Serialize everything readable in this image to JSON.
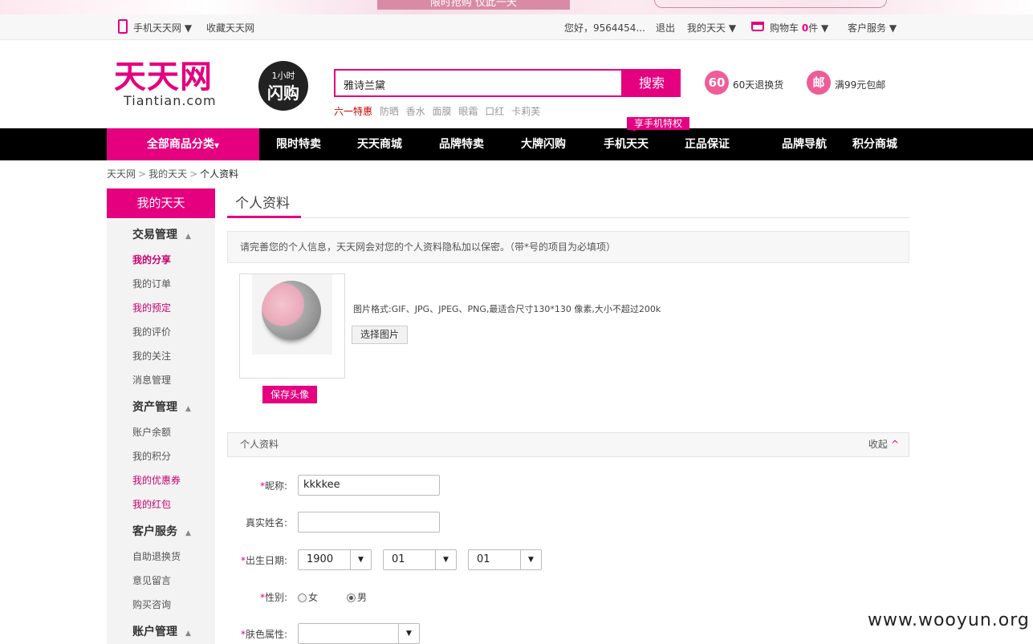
{
  "banner": {
    "text": "限时抢购 仅此一天"
  },
  "topbar": {
    "mobile": "手机天天网",
    "favorite": "收藏天天网",
    "greeting": "您好，9564454...",
    "logout": "退出",
    "my_tiantian": "我的天天",
    "cart": "购物车",
    "cart_count": "0",
    "cart_unit": "件",
    "service": "客户服务"
  },
  "header": {
    "logo": "天天网",
    "logo_sub": "Tiantian.com",
    "flash_line1": "1小时",
    "flash_line2": "闪购",
    "search_value": "雅诗兰黛",
    "search_button": "搜索",
    "hotwords": [
      "六一特惠",
      "防晒",
      "香水",
      "面膜",
      "眼霜",
      "口红",
      "卡莉芙"
    ],
    "badge1": "60",
    "badge1_text": "60天退换货",
    "badge2": "邮",
    "badge2_text": "满99元包邮"
  },
  "nav": {
    "all": "全部商品分类",
    "items": [
      "限时特卖",
      "天天商城",
      "品牌特卖",
      "大牌闪购",
      "手机天天",
      "正品保证",
      "品牌导航",
      "积分商城"
    ],
    "tip": "享手机特权"
  },
  "breadcrumb": [
    "天天网",
    "我的天天",
    "个人资料"
  ],
  "sidebar": {
    "head": "我的天天",
    "groups": [
      {
        "title": "交易管理",
        "items": [
          "我的分享",
          "我的订单",
          "我的预定",
          "我的评价",
          "我的关注",
          "消息管理"
        ]
      },
      {
        "title": "资产管理",
        "items": [
          "账户余额",
          "我的积分",
          "我的优惠券",
          "我的红包"
        ]
      },
      {
        "title": "客户服务",
        "items": [
          "自助退换货",
          "意见留言",
          "购买咨询"
        ]
      },
      {
        "title": "账户管理",
        "items": []
      }
    ]
  },
  "content": {
    "title": "个人资料",
    "notice": "请完善您的个人信息，天天网会对您的个人资料隐私加以保密。（带*号的项目为必填项）",
    "avatar_format": "图片格式:GIF、JPG、JPEG、PNG,最适合尺寸130*130 像素,大小不超过200k",
    "choose_image": "选择图片",
    "save_avatar": "保存头像",
    "section_title": "个人资料",
    "collapse": "收起",
    "form": {
      "nickname_label": "昵称:",
      "nickname_value": "kkkkee",
      "realname_label": "真实姓名:",
      "realname_value": "",
      "birthday_label": "出生日期:",
      "birth_year": "1900",
      "birth_month": "01",
      "birth_day": "01",
      "gender_label": "性别:",
      "gender_female": "女",
      "gender_male": "男",
      "skin_label": "肤色属性:",
      "skin_value": "",
      "required_mark": "*"
    }
  },
  "watermark": "www.wooyun.org"
}
